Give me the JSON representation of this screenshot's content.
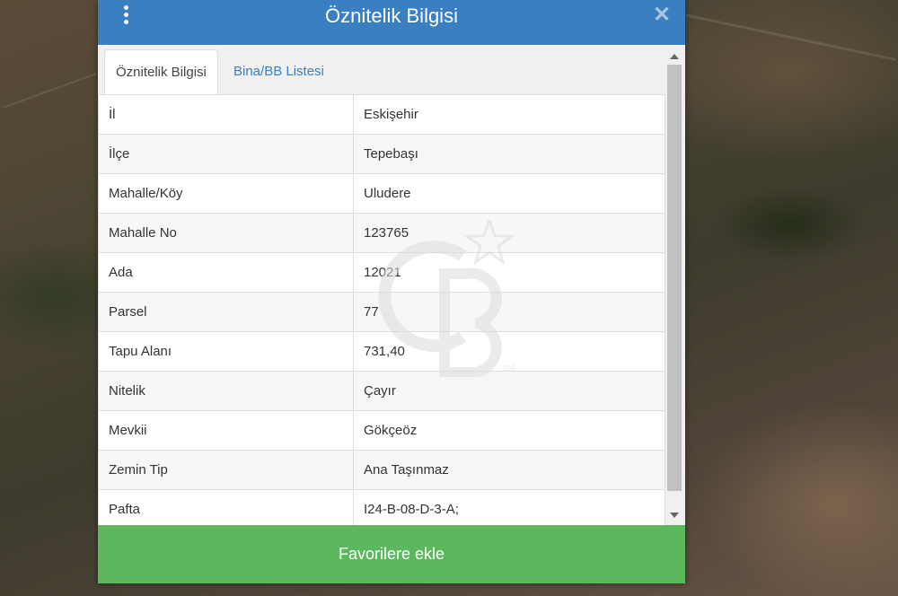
{
  "header": {
    "title": "Öznitelik Bilgisi"
  },
  "icons": {
    "menu": "vertical-ellipsis-icon",
    "close": "close-icon"
  },
  "tabs": [
    {
      "label": "Öznitelik Bilgisi",
      "active": true
    },
    {
      "label": "Bina/BB Listesi",
      "active": false
    }
  ],
  "rows": [
    {
      "key": "İl",
      "value": "Eskişehir"
    },
    {
      "key": "İlçe",
      "value": "Tepebaşı"
    },
    {
      "key": "Mahalle/Köy",
      "value": "Uludere"
    },
    {
      "key": "Mahalle No",
      "value": "123765"
    },
    {
      "key": "Ada",
      "value": "12021"
    },
    {
      "key": "Parsel",
      "value": "77"
    },
    {
      "key": "Tapu Alanı",
      "value": "731,40"
    },
    {
      "key": "Nitelik",
      "value": "Çayır"
    },
    {
      "key": "Mevkii",
      "value": "Gökçeöz"
    },
    {
      "key": "Zemin Tip",
      "value": "Ana Taşınmaz"
    },
    {
      "key": "Pafta",
      "value": "I24-B-08-D-3-A;"
    }
  ],
  "footer": {
    "button_label": "Favorilere ekle"
  },
  "watermark": {
    "text": "CB",
    "mark": "SM"
  },
  "colors": {
    "header": "#3a7fc1",
    "button": "#5cb85c",
    "tab_link": "#3a7fc1"
  }
}
